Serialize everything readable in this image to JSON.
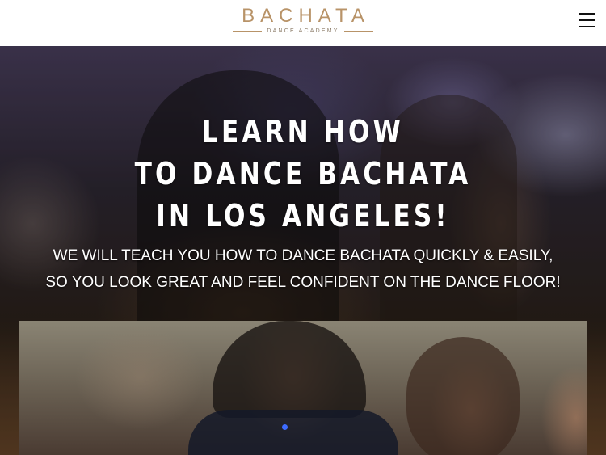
{
  "header": {
    "logo_title": "BACHATA",
    "logo_subtitle": "DANCE ACADEMY",
    "menu_icon": "hamburger-menu-icon"
  },
  "hero": {
    "title_lines": [
      "LEARN HOW",
      "TO DANCE BACHATA",
      "IN LOS ANGELES!"
    ],
    "subtitle_lines": [
      "WE WILL TEACH YOU HOW TO DANCE BACHATA QUICKLY & EASILY,",
      "SO YOU LOOK GREAT AND FEEL CONFIDENT ON THE DANCE FLOOR!"
    ]
  },
  "colors": {
    "brand_gold": "#b89368",
    "header_bg": "#ffffff",
    "hero_text": "#ffffff"
  }
}
